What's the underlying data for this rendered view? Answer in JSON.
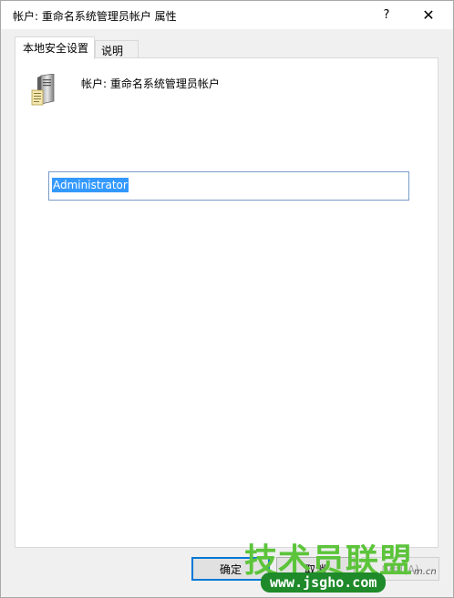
{
  "window": {
    "title": "帐户: 重命名系统管理员帐户 属性",
    "help_label": "?",
    "close_label": "✕"
  },
  "tabs": [
    {
      "label": "本地安全设置",
      "active": true
    },
    {
      "label": "说明",
      "active": false
    }
  ],
  "panel": {
    "icon": "server-icon",
    "account_label": "帐户: 重命名系统管理员帐户",
    "input_value": "Administrator"
  },
  "buttons": {
    "ok": "确定",
    "cancel": "取消",
    "apply": "应用(A)"
  },
  "watermark": {
    "title": "技术员联盟",
    "url": "www.jsgho.com",
    "suffix": "m.cn"
  },
  "colors": {
    "selection": "#3399ff",
    "input_border": "#7a9cc9",
    "ok_border": "#0078d7",
    "watermark_green": "#5cc43a"
  }
}
